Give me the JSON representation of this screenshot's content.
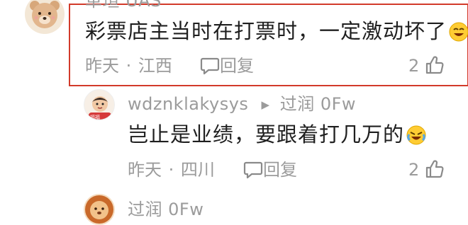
{
  "comments": [
    {
      "username": "革瑄 UAS",
      "text": "彩票店主当时在打票时，一定激动坏了",
      "meta_time": "昨天",
      "meta_sep": "·",
      "meta_location": "江西",
      "reply_label": "回复",
      "like_count": "2"
    },
    {
      "username": "wdznklakysys",
      "reply_arrow": "▶",
      "reply_to": "过润 0Fw",
      "text": "岂止是业绩，要跟着打几万的",
      "meta_time": "昨天",
      "meta_sep": "·",
      "meta_location": "四川",
      "reply_label": "回复",
      "like_count": "2"
    },
    {
      "username": "过润 0Fw"
    }
  ],
  "colors": {
    "highlight_border": "#d23a2a",
    "muted_text": "#9b9b9b"
  },
  "icons": [
    "bear-avatar-icon",
    "person-avatar-icon",
    "lion-avatar-icon",
    "comment-bubble-icon",
    "thumbs-up-icon",
    "laughing-emoji-icon",
    "crying-laughing-emoji-icon"
  ]
}
